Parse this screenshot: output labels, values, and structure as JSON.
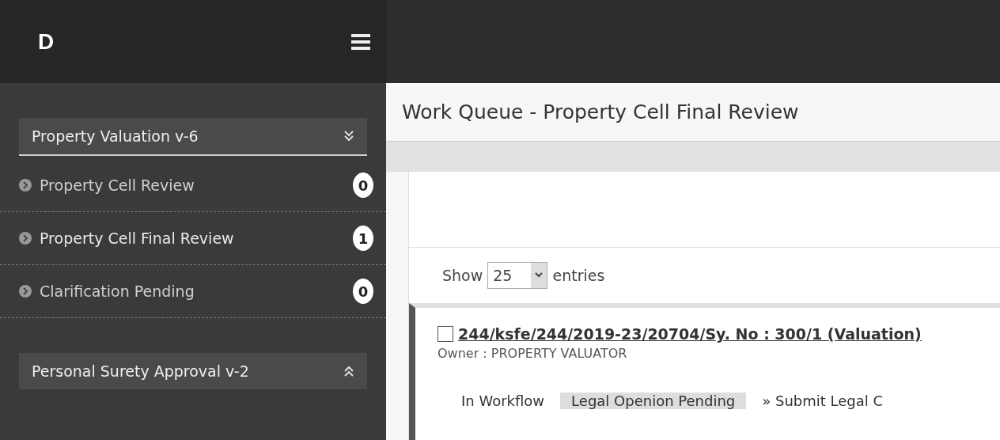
{
  "logo": {
    "text": "D"
  },
  "sidebar": {
    "groups": [
      {
        "label": "Property Valuation v-6",
        "expanded": true,
        "items": [
          {
            "label": "Property Cell Review",
            "count": "0",
            "selected": false
          },
          {
            "label": "Property Cell Final Review",
            "count": "1",
            "selected": true
          },
          {
            "label": "Clarification Pending",
            "count": "0",
            "selected": false
          }
        ]
      },
      {
        "label": "Personal Surety Approval v-2",
        "expanded": false
      }
    ]
  },
  "page_title": "Work Queue - Property Cell Final Review",
  "length_menu": {
    "before": "Show",
    "value": "25",
    "after": "entries"
  },
  "tasks": [
    {
      "checked": false,
      "link": "244/ksfe/244/2019-23/20704/Sy. No : 300/1 (Valuation)",
      "owner_label": "Owner :",
      "owner": "PROPERTY VALUATOR",
      "workflow_label": "In  Workflow",
      "status": "Legal Openion Pending",
      "action": "» Submit Legal C"
    }
  ]
}
